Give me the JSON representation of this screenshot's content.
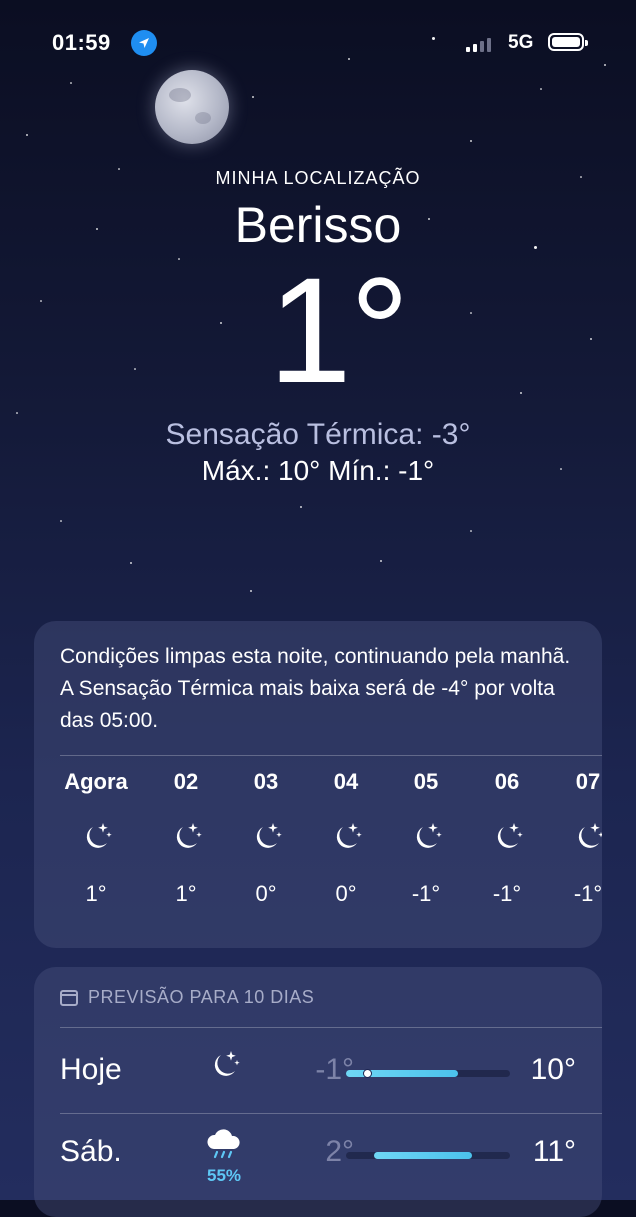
{
  "status_bar": {
    "time": "01:59",
    "network": "5G"
  },
  "header": {
    "location_label": "MINHA LOCALIZAÇÃO",
    "city": "Berisso",
    "temperature": "1°",
    "feels_like": "Sensação Térmica: -3°",
    "high_low": "Máx.: 10°  Mín.: -1°"
  },
  "hourly_card": {
    "summary": "Condições limpas esta noite, continuando pela manhã. A Sensação Térmica mais baixa será de -4° por volta das 05:00.",
    "hours": [
      {
        "label": "Agora",
        "icon": "moon-stars-icon",
        "temp": "1°"
      },
      {
        "label": "02",
        "icon": "moon-stars-icon",
        "temp": "1°"
      },
      {
        "label": "03",
        "icon": "moon-stars-icon",
        "temp": "0°"
      },
      {
        "label": "04",
        "icon": "moon-stars-icon",
        "temp": "0°"
      },
      {
        "label": "05",
        "icon": "moon-stars-icon",
        "temp": "-1°"
      },
      {
        "label": "06",
        "icon": "moon-stars-icon",
        "temp": "-1°"
      },
      {
        "label": "07",
        "icon": "moon-stars-icon",
        "temp": "-1°"
      }
    ]
  },
  "forecast": {
    "title": "PREVISÃO PARA 10 DIAS",
    "days": [
      {
        "day": "Hoje",
        "icon": "moon-stars-icon",
        "precip": "",
        "low": "-1°",
        "high": "10°",
        "range_start": 0.0,
        "range_end": 0.68,
        "current_marker": 0.13
      },
      {
        "day": "Sáb.",
        "icon": "cloud-rain-icon",
        "precip": "55%",
        "low": "2°",
        "high": "11°",
        "range_start": 0.17,
        "range_end": 0.77
      }
    ]
  },
  "colors": {
    "accent_blue": "#1f8ef1",
    "bar_fill": "#5ec8f5",
    "precip": "#5ec8f5"
  }
}
